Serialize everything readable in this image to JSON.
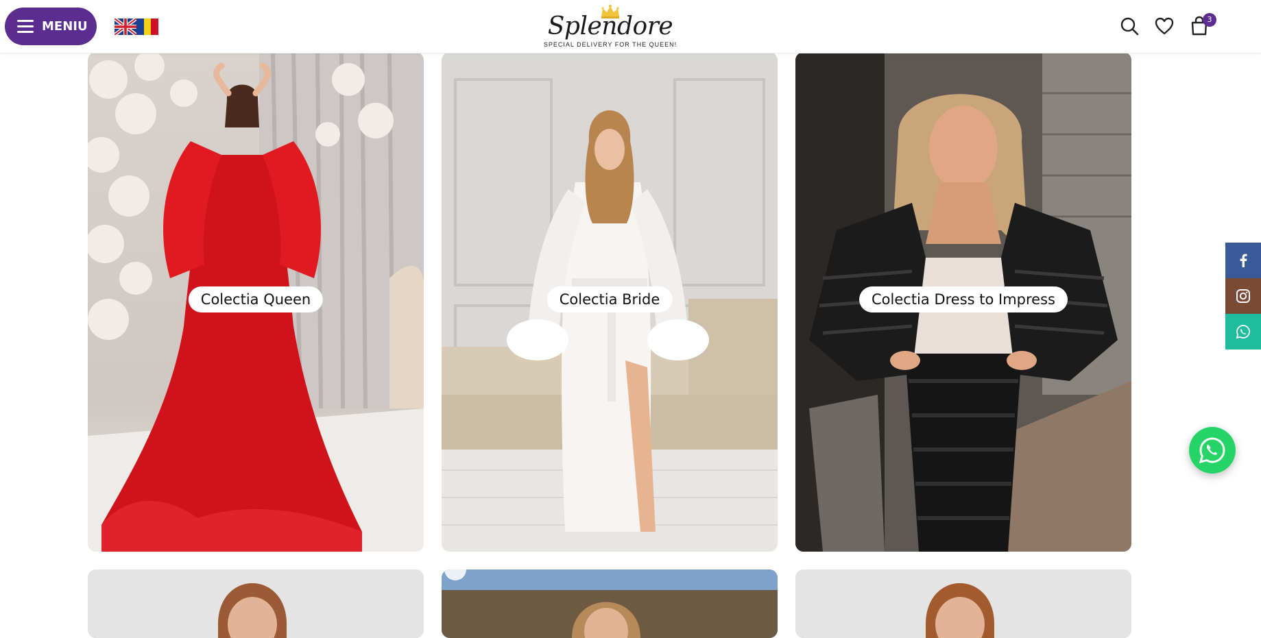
{
  "header": {
    "menu_label": "MENIU",
    "logo_text": "Splendore",
    "logo_tagline": "SPECIAL DELIVERY FOR THE QUEEN!",
    "cart_count": "3",
    "languages": [
      "en-flag-icon",
      "ro-flag-icon"
    ],
    "icons": [
      "search-icon",
      "heart-icon",
      "shopping-bag-icon"
    ]
  },
  "collections": [
    {
      "label": "Colectia Queen"
    },
    {
      "label": "Colectia Bride"
    },
    {
      "label": "Colectia Dress to Impress"
    }
  ],
  "social": [
    "facebook-icon",
    "instagram-icon",
    "whatsapp-icon"
  ],
  "colors": {
    "brand_purple": "#5b2d91",
    "facebook": "#3a5998",
    "instagram": "#7a4a35",
    "whatsapp_side": "#1fbd9e",
    "whatsapp_float": "#25d366"
  }
}
